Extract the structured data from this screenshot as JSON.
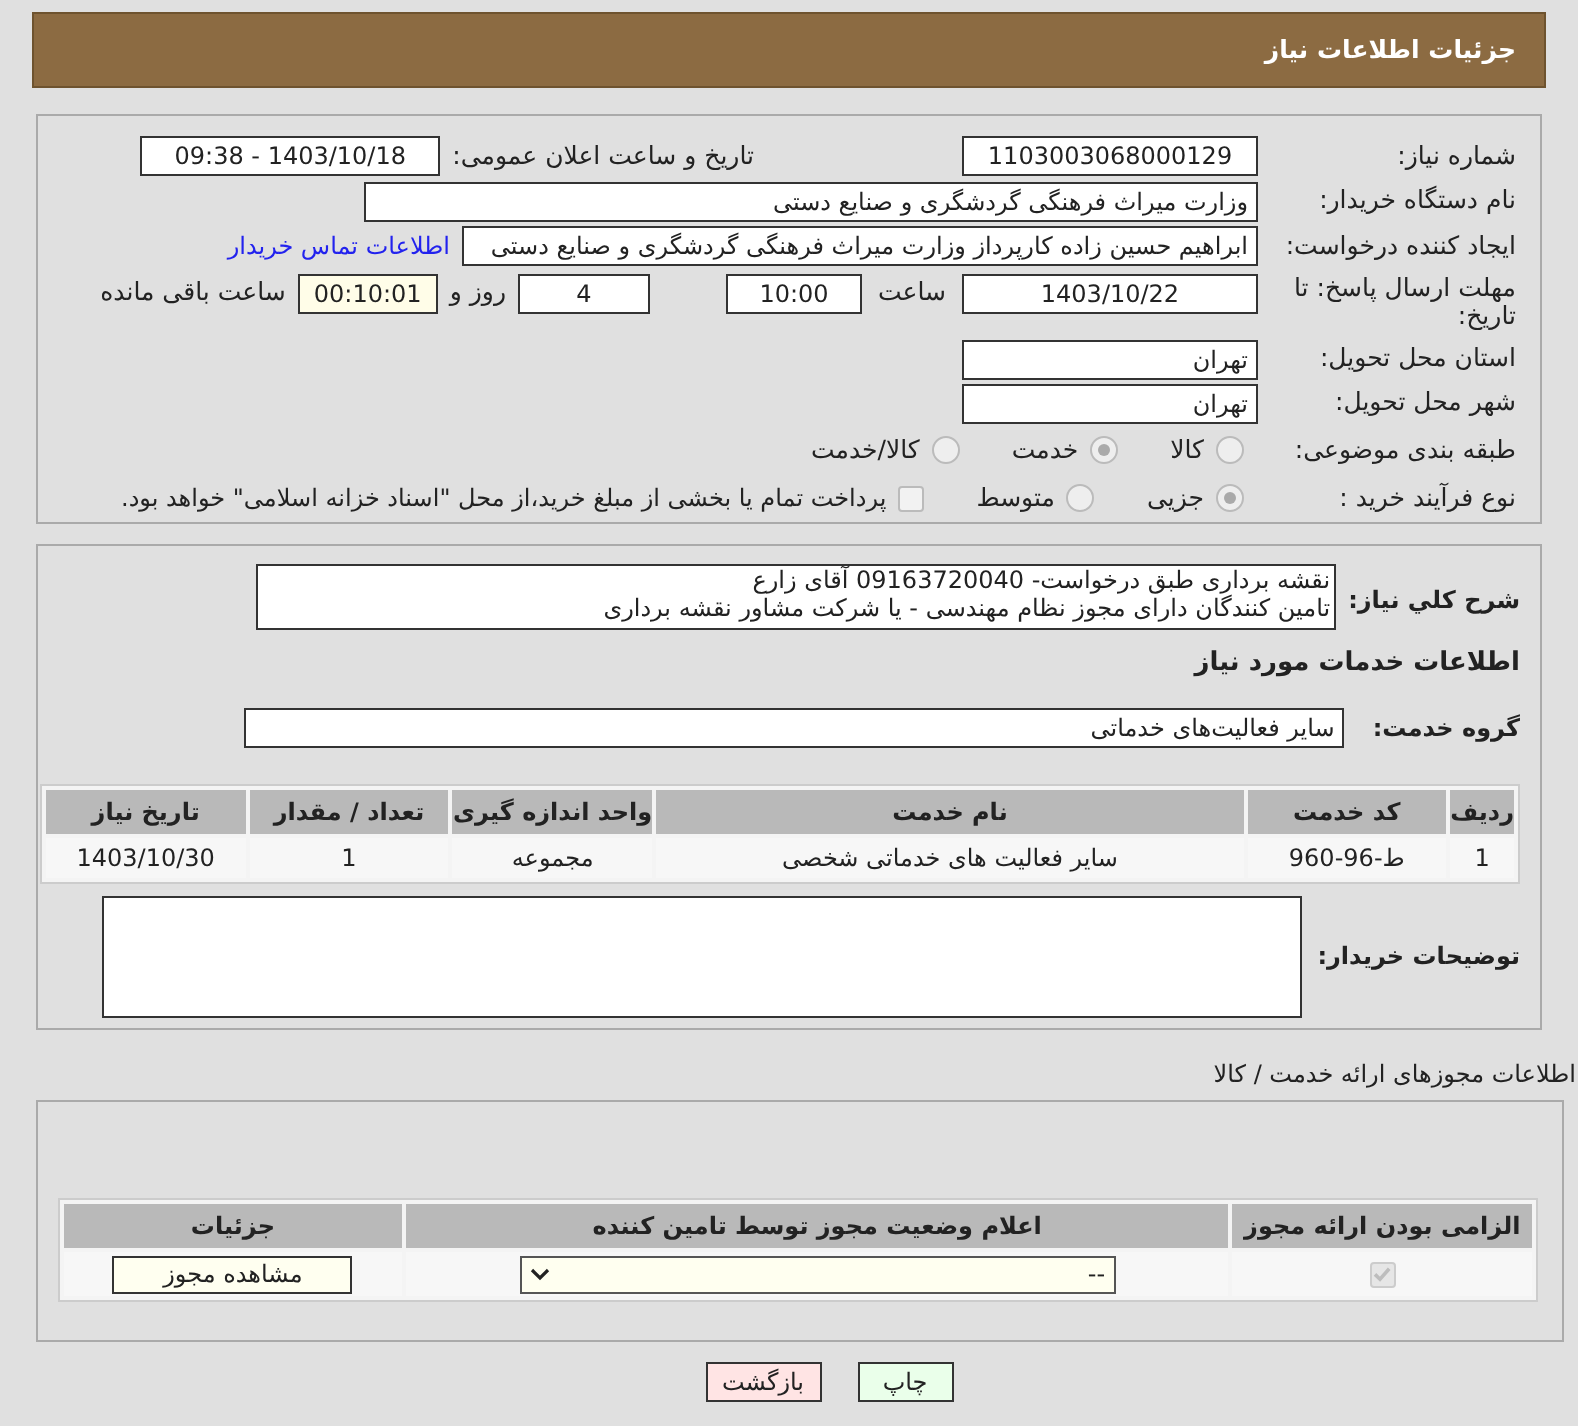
{
  "header": {
    "title": "جزئیات اطلاعات نیاز"
  },
  "need_info": {
    "need_number": {
      "label": "شماره نیاز:",
      "value": "1103003068000129"
    },
    "announce_datetime": {
      "label": "تاریخ و ساعت اعلان عمومی:",
      "value": "1403/10/18 - 09:38"
    },
    "buyer_org": {
      "label": "نام دستگاه خریدار:",
      "value": "وزارت میراث فرهنگی  گردشگری و صنایع دستی"
    },
    "requester": {
      "label": "ایجاد کننده درخواست:",
      "value": "ابراهیم حسین زاده کارپرداز وزارت میراث فرهنگی  گردشگری و صنایع دستی",
      "link": "اطلاعات تماس خریدار"
    },
    "deadline": {
      "label": "مهلت ارسال پاسخ: تا تاریخ:",
      "date": "1403/10/22",
      "time_label": "ساعت",
      "time": "10:00",
      "days": "4",
      "days_label": "روز و",
      "remaining": "00:10:01",
      "remaining_label": "ساعت باقی مانده"
    },
    "province": {
      "label": "استان محل تحویل:",
      "value": "تهران"
    },
    "city": {
      "label": "شهر محل تحویل:",
      "value": "تهران"
    },
    "category": {
      "label": "طبقه بندی موضوعی:",
      "options": [
        {
          "label": "کالا",
          "selected": false
        },
        {
          "label": "خدمت",
          "selected": true
        },
        {
          "label": "کالا/خدمت",
          "selected": false
        }
      ]
    },
    "purchase_type": {
      "label": "نوع فرآیند خرید :",
      "options": [
        {
          "label": "جزیی",
          "selected": true
        },
        {
          "label": "متوسط",
          "selected": false
        }
      ],
      "treasury": {
        "checked": false,
        "text": "پرداخت تمام یا بخشی از مبلغ خرید،از محل \"اسناد خزانه اسلامی\" خواهد بود."
      }
    }
  },
  "services": {
    "description": {
      "label": "شرح کلي نياز:",
      "lines": [
        "نقشه برداری طبق درخواست- 09163720040 آقای زارع",
        "تامین کنندگان دارای مجوز نظام مهندسی - یا شرکت مشاور نقشه برداری"
      ]
    },
    "heading": "اطلاعات خدمات مورد نیاز",
    "service_group": {
      "label": "گروه خدمت:",
      "value": "سایر فعالیت‌های خدماتی"
    },
    "table": {
      "columns": [
        "ردیف",
        "کد خدمت",
        "نام خدمت",
        "واحد اندازه گیری",
        "تعداد / مقدار",
        "تاریخ نیاز"
      ],
      "rows": [
        [
          "1",
          "ط-96-960",
          "سایر فعالیت های خدماتی شخصی",
          "مجموعه",
          "1",
          "1403/10/30"
        ]
      ]
    },
    "buyer_notes": {
      "label": "توضیحات خریدار:"
    }
  },
  "permits": {
    "title": "اطلاعات مجوزهای ارائه خدمت / کالا",
    "table": {
      "columns": [
        "الزامی بودن ارائه مجوز",
        "اعلام وضعیت مجوز توسط تامین کننده",
        "جزئیات"
      ],
      "rows": [
        {
          "required": true,
          "status": "--",
          "details_button": "مشاهده مجوز"
        }
      ]
    }
  },
  "buttons": [
    {
      "label": "چاپ",
      "kind": "print"
    },
    {
      "label": "بازگشت",
      "kind": "back"
    }
  ]
}
